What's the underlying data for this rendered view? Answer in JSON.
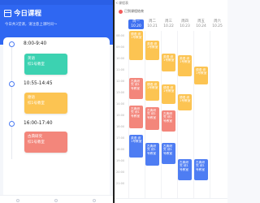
{
  "left": {
    "title": "今日课程",
    "subtitle": "今日共3堂课，请注意上课时间～",
    "slots": [
      {
        "time": "8:00-9:40",
        "course": "英语",
        "room": "综1号教室",
        "color": "#3cd2b1"
      },
      {
        "time": "10:55-14:45",
        "course": "德语",
        "room": "综1号教室",
        "color": "#fcc452"
      },
      {
        "time": "16:00-17:40",
        "course": "古典研究",
        "room": "综1号教室",
        "color": "#f3867b"
      }
    ]
  },
  "right": {
    "back": "<",
    "title": "课程表",
    "today_label": "已到课程结束",
    "days": [
      {
        "name": "周一",
        "date": "10.20"
      },
      {
        "name": "周二",
        "date": "10.21"
      },
      {
        "name": "周三",
        "date": "10.22"
      },
      {
        "name": "周四",
        "date": "10.23"
      },
      {
        "name": "周五",
        "date": "10.24"
      },
      {
        "name": "周六",
        "date": "10.25"
      }
    ],
    "times": [
      "08:00",
      "09:00",
      "10:00",
      "11:00",
      "12:00",
      "13:00",
      "14:00",
      "15:00",
      "16:00",
      "17:00",
      "18:00",
      "19:00",
      "20:00",
      "21:00"
    ],
    "blocks": [
      {
        "text": "德语 综1号教室",
        "color": "orange"
      },
      {
        "text": "英语 综1号教室",
        "color": "orange"
      },
      {
        "text": "英语 综1号教室",
        "color": "orange"
      },
      {
        "text": "英语 综1号教室",
        "color": "orange"
      },
      {
        "text": "德语 综1号教室",
        "color": "orange"
      },
      {
        "text": "古典研究 综1号教室",
        "color": "red"
      },
      {
        "text": "德语 综1号教室",
        "color": "orange"
      },
      {
        "text": "德语 综1号教室",
        "color": "orange"
      },
      {
        "text": "德语 综1号教室",
        "color": "orange"
      },
      {
        "text": "古典研究 综1号教室",
        "color": "red"
      },
      {
        "text": "古典研究 综1号教室",
        "color": "red"
      },
      {
        "text": "古典研究 综1号教室",
        "color": "red"
      },
      {
        "text": "英语 综1号教室",
        "color": "blue"
      },
      {
        "text": "古典研究 综1号教室",
        "color": "blue"
      },
      {
        "text": "古典研究 综1号教室",
        "color": "blue"
      },
      {
        "text": "古典研究 综1号教室",
        "color": "blue"
      },
      {
        "text": "古典研究 综1号教室",
        "color": "blue"
      }
    ]
  }
}
